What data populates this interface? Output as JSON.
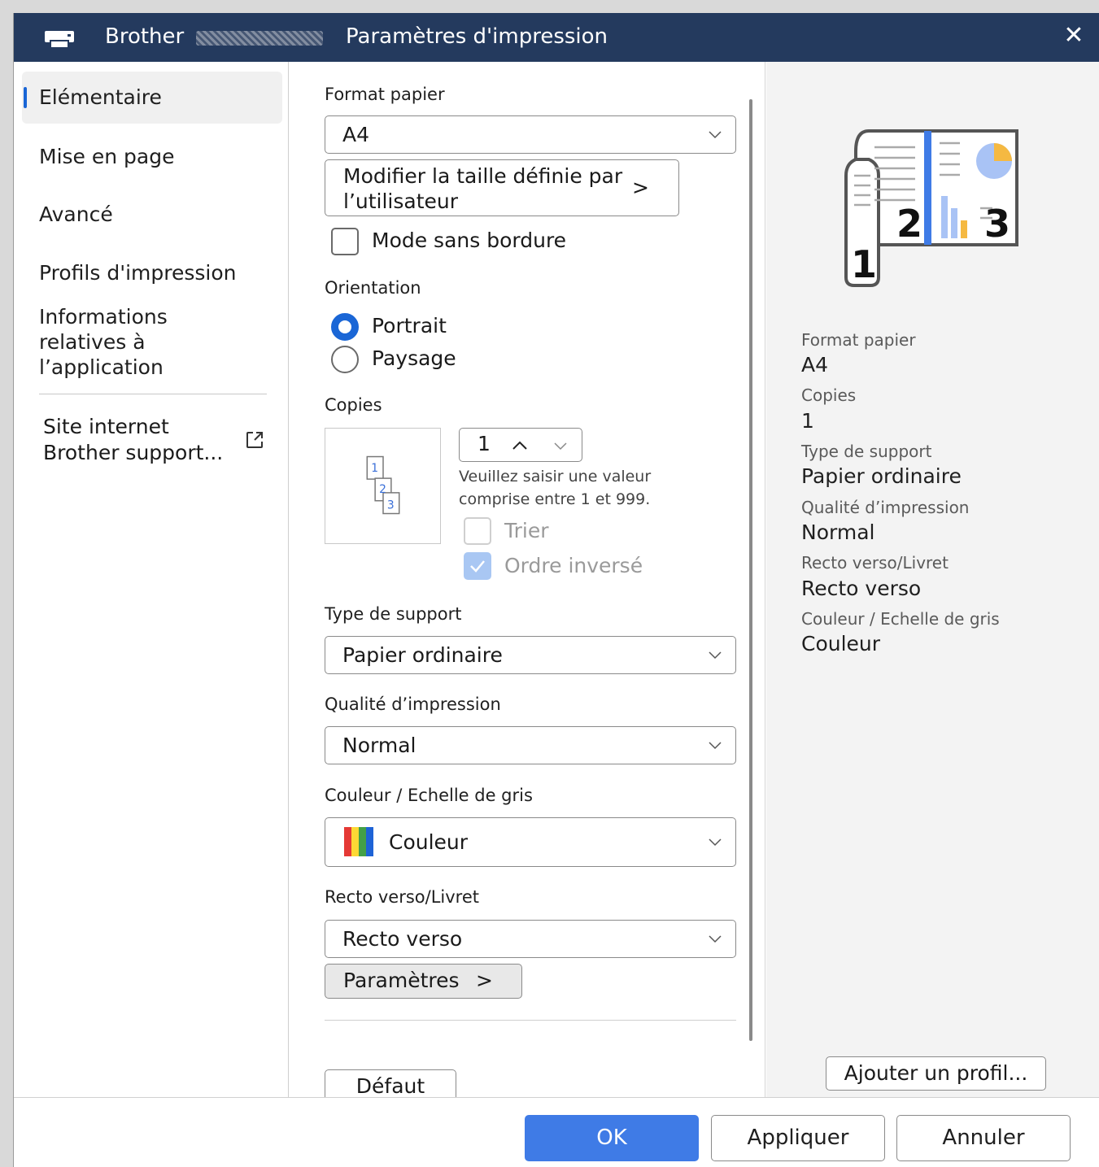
{
  "window": {
    "brand": "Brother",
    "title": "Paramètres d'impression",
    "close_glyph": "✕"
  },
  "sidebar": {
    "items": [
      {
        "label": "Elémentaire",
        "active": true
      },
      {
        "label": "Mise en page"
      },
      {
        "label": "Avancé"
      },
      {
        "label": "Profils d'impression"
      },
      {
        "label": "Informations relatives à l’application"
      }
    ],
    "support_link": "Site internet Brother support...",
    "support_icon": "external-link-icon"
  },
  "main": {
    "paper_size": {
      "label": "Format papier",
      "value": "A4"
    },
    "custom_size_button": "Modifier la taille définie par l’utilisateur",
    "custom_size_arrow": ">",
    "borderless": {
      "label": "Mode sans bordure",
      "checked": false
    },
    "orientation": {
      "label": "Orientation",
      "options": [
        "Portrait",
        "Paysage"
      ],
      "selected": "Portrait"
    },
    "copies": {
      "label": "Copies",
      "value": "1",
      "hint": "Veuillez saisir une valeur comprise entre 1 et 999.",
      "collate": {
        "label": "Trier",
        "checked": false,
        "disabled": true
      },
      "reverse": {
        "label": "Ordre inversé",
        "checked": true,
        "disabled": true
      },
      "icon_pages": [
        "1",
        "2",
        "3"
      ]
    },
    "media_type": {
      "label": "Type de support",
      "value": "Papier ordinaire"
    },
    "print_quality": {
      "label": "Qualité d’impression",
      "value": "Normal"
    },
    "color": {
      "label": "Couleur / Echelle de gris",
      "value": "Couleur"
    },
    "duplex": {
      "label": "Recto verso/Livret",
      "value": "Recto verso",
      "settings_button": "Paramètres",
      "settings_arrow": ">"
    },
    "default_button": "Défaut"
  },
  "summary": {
    "preview_pages": [
      "1",
      "2",
      "3"
    ],
    "rows": [
      {
        "label": "Format papier",
        "value": "A4"
      },
      {
        "label": "Copies",
        "value": "1"
      },
      {
        "label": "Type de support",
        "value": "Papier ordinaire"
      },
      {
        "label": "Qualité d’impression",
        "value": "Normal"
      },
      {
        "label": "Recto verso/Livret",
        "value": "Recto verso"
      },
      {
        "label": "Couleur / Echelle de gris",
        "value": "Couleur"
      }
    ],
    "add_profile_button": "Ajouter un profil..."
  },
  "footer": {
    "ok": "OK",
    "apply": "Appliquer",
    "cancel": "Annuler"
  },
  "colors": {
    "titlebar": "#243a5e",
    "accent": "#1a66d6",
    "primary_button": "#3f7be6"
  }
}
